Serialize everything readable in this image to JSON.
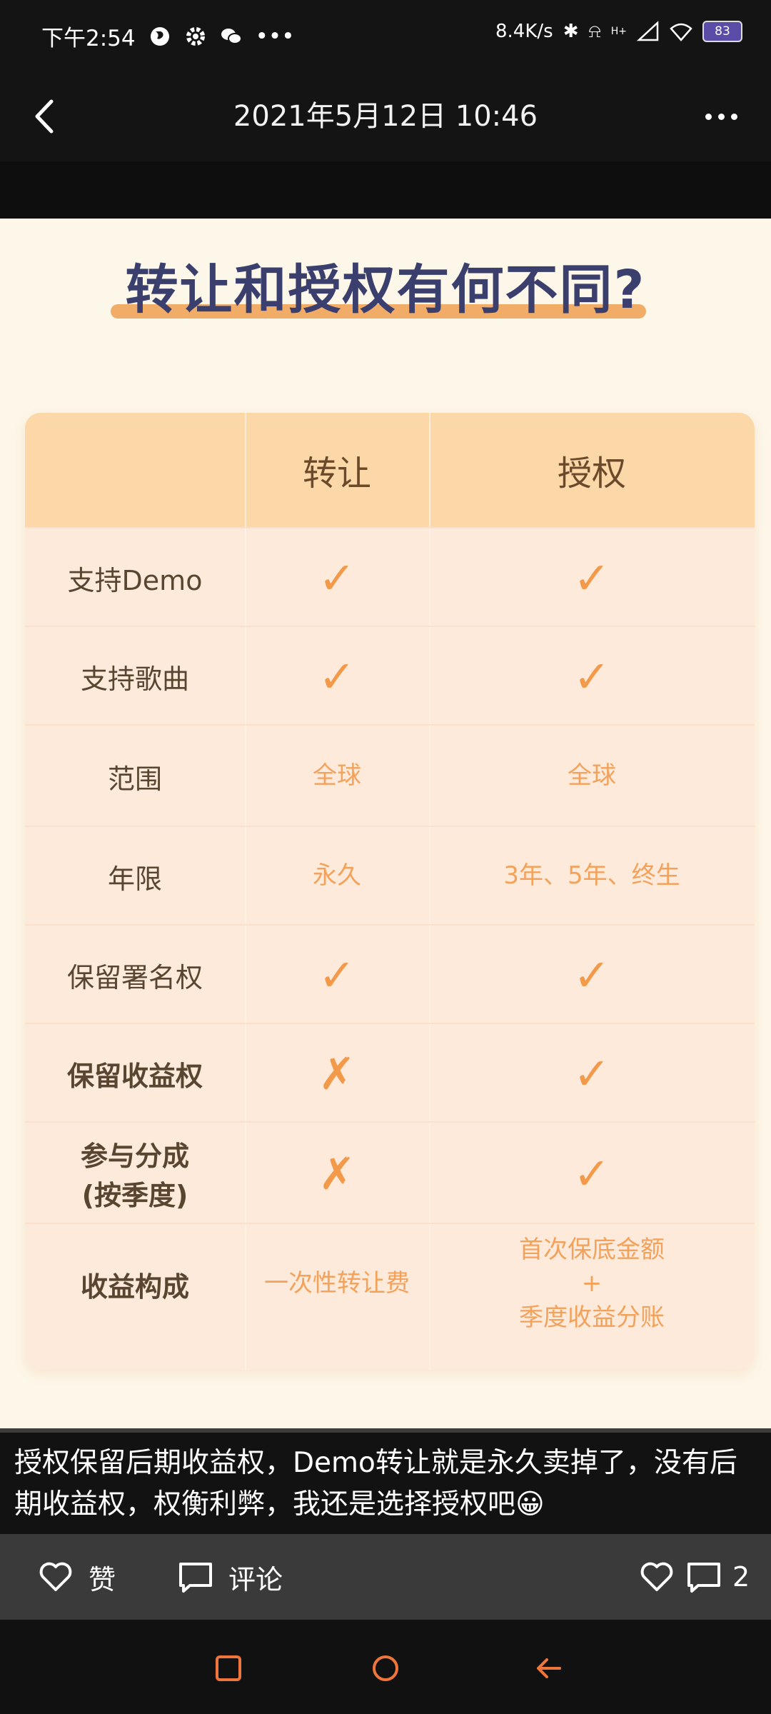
{
  "status_bar": {
    "time": "下午2:54",
    "network_speed": "8.4K/s",
    "signal_label": "H+",
    "battery": "83",
    "more_dots": "•••"
  },
  "header": {
    "title": "2021年5月12日 10:46"
  },
  "image": {
    "title": "转让和授权有何不同?",
    "table": {
      "headers": [
        "",
        "转让",
        "授权"
      ],
      "rows": [
        {
          "label": "支持Demo",
          "transfer": "✓",
          "license": "✓"
        },
        {
          "label": "支持歌曲",
          "transfer": "✓",
          "license": "✓"
        },
        {
          "label": "范围",
          "transfer": "全球",
          "license": "全球"
        },
        {
          "label": "年限",
          "transfer": "永久",
          "license": "3年、5年、终生"
        },
        {
          "label": "保留署名权",
          "transfer": "✓",
          "license": "✓"
        },
        {
          "label": "保留收益权",
          "transfer": "✗",
          "license": "✓"
        },
        {
          "label": "参与分成\n(按季度)",
          "transfer": "✗",
          "license": "✓"
        },
        {
          "label": "收益构成",
          "transfer": "一次性转让费",
          "license": "首次保底金额\n+\n季度收益分账"
        }
      ]
    }
  },
  "caption": "授权保留后期收益权，Demo转让就是永久卖掉了，没有后期收益权，权衡利弊，我还是选择授权吧😀",
  "actions": {
    "like_label": "赞",
    "comment_label": "评论",
    "comment_count": "2"
  },
  "colors": {
    "accent_orange": "#f39a4a",
    "table_header": "#fcd8a9",
    "title_navy": "#3b3f6d"
  }
}
